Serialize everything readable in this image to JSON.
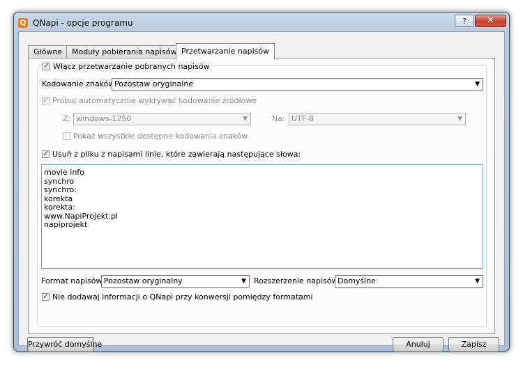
{
  "window": {
    "app_icon_letter": "Q",
    "title": "QNapi - opcje programu",
    "help_label": "?",
    "close_label": "✕"
  },
  "tabs": [
    {
      "label": "Główne"
    },
    {
      "label": "Moduły pobierania napisów"
    },
    {
      "label": "Przetwarzanie napisów"
    }
  ],
  "processing": {
    "enable_label": "Włącz przetwarzanie pobranych napisów",
    "encoding_label": "Kodowanie znaków:",
    "encoding_value": "Pozostaw oryginalne",
    "autodetect_label": "Próbuj automatycznie wykrywać kodowanie źródłowe",
    "from_label": "Z:",
    "from_value": "windows-1250",
    "to_label": "Na:",
    "to_value": "UTF-8",
    "show_all_label": "Pokaż wszystkie dostępne kodowania znaków",
    "remove_lines_label": "Usuń z pliku z napisami linie, które zawierają następujące słowa:",
    "words": [
      "movie info",
      "synchro",
      "synchro:",
      "korekta",
      "korekta:",
      "www.NapiProjekt.pl",
      "napiprojekt"
    ],
    "format_label": "Format napisów:",
    "format_value": "Pozostaw oryginalny",
    "extension_label": "Rozszerzenie napisów:",
    "extension_value": "Domyślne",
    "no_info_label": "Nie dodawaj informacji o QNapi przy konwersji pomiędzy formatami"
  },
  "footer": {
    "restore_label": "Przywróć domyślne",
    "cancel_label": "Anuluj",
    "save_label": "Zapisz"
  },
  "colors": {
    "accent": "#ff7a00",
    "close": "#c8402c"
  }
}
